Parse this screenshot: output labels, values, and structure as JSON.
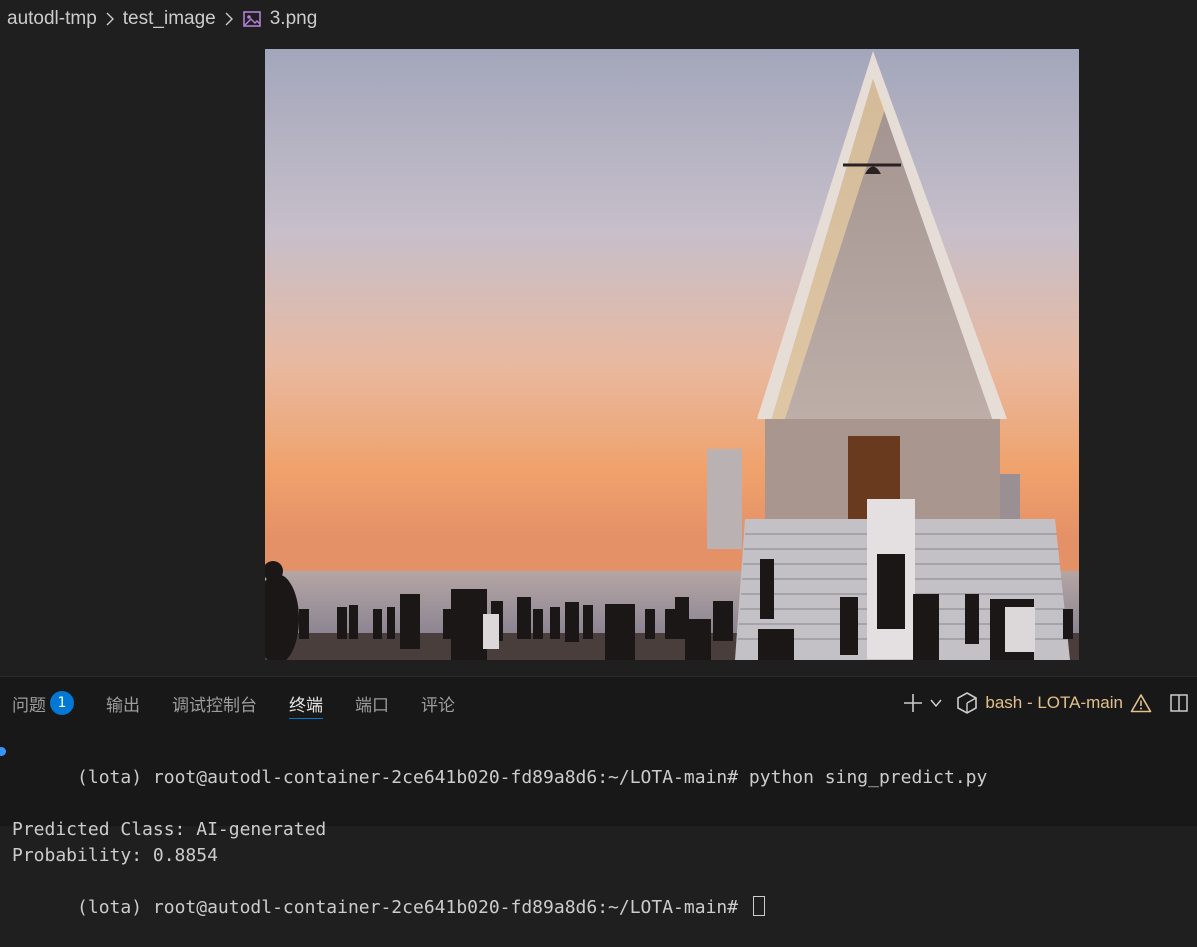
{
  "breadcrumb": {
    "items": [
      "autodl-tmp",
      "test_image",
      "3.png"
    ]
  },
  "panel": {
    "tabs": [
      {
        "label": "问题",
        "badge": "1"
      },
      {
        "label": "输出"
      },
      {
        "label": "调试控制台"
      },
      {
        "label": "终端",
        "active": true
      },
      {
        "label": "端口"
      },
      {
        "label": "评论"
      }
    ],
    "terminal_name": "bash - LOTA-main"
  },
  "terminal": {
    "lines": [
      "(lota) root@autodl-container-2ce641b020-fd89a8d6:~/LOTA-main# python sing_predict.py",
      "Predicted Class: AI-generated",
      "Probability: 0.8854",
      "(lota) root@autodl-container-2ce641b020-fd89a8d6:~/LOTA-main# "
    ]
  },
  "colors": {
    "accent": "#0078d4",
    "warning": "#e2c08d",
    "background": "#1f1f1f",
    "panel_background": "#181818"
  },
  "icons": [
    "chevron-right-icon",
    "image-file-icon",
    "plus-icon",
    "chevron-down-icon",
    "terminal-profile-icon",
    "warning-icon",
    "split-panel-icon"
  ]
}
